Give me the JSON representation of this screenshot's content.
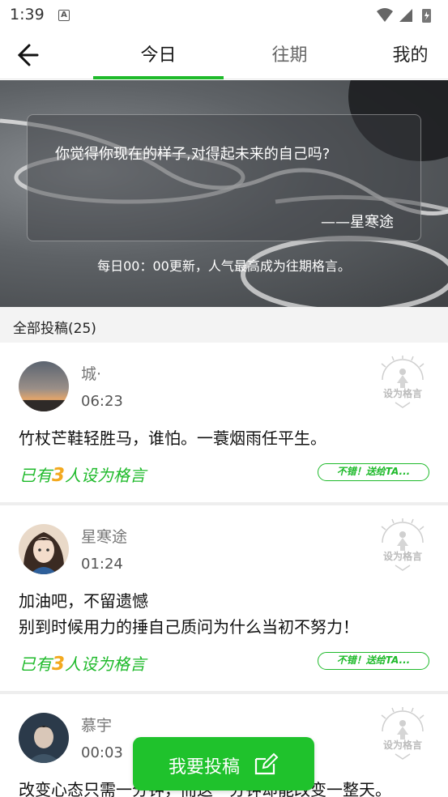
{
  "status_bar": {
    "time": "1:39",
    "notification_icon": "A"
  },
  "header": {
    "tabs": [
      {
        "label": "今日",
        "active": true
      },
      {
        "label": "往期",
        "active": false
      },
      {
        "label": "我的",
        "active": false
      }
    ]
  },
  "banner": {
    "quote": "你觉得你现在的样子,对得起未来的自己吗?",
    "author": "——星寒途",
    "note": "每日00：00更新，人气最高成为往期格言。"
  },
  "section": {
    "title": "全部投稿(25)"
  },
  "stamp_label": "设为格言",
  "posts": [
    {
      "name": "城·",
      "time": "06:23",
      "lines": [
        "竹杖芒鞋轻胜马，谁怕。一蓑烟雨任平生。"
      ],
      "count_prefix": "已有",
      "count": "3",
      "count_suffix": "人设为格言",
      "gift_label": "不错！送给TA..."
    },
    {
      "name": "星寒途",
      "time": "01:24",
      "lines": [
        "加油吧，不留遗憾",
        "别到时候用力的捶自己质问为什么当初不努力！"
      ],
      "count_prefix": "已有",
      "count": "3",
      "count_suffix": "人设为格言",
      "gift_label": "不错！送给TA..."
    },
    {
      "name": "慕宇",
      "time": "00:03",
      "lines": [
        "改变心态只需一分钟，而这一分钟却能改变一整天。"
      ]
    }
  ],
  "submit": {
    "label": "我要投稿"
  },
  "colors": {
    "accent": "#1fba2b",
    "count_number": "#f3a91f"
  }
}
